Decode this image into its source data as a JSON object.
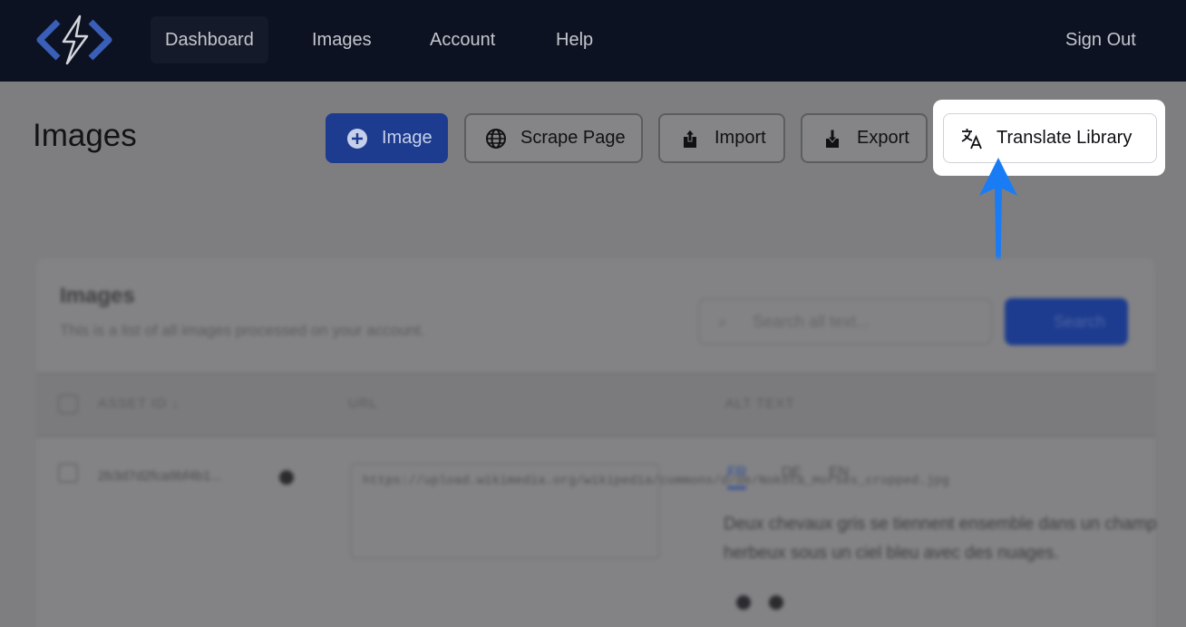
{
  "navbar": {
    "logo": "lightning-bolt-logo",
    "items": [
      {
        "label": "Dashboard",
        "active": true
      },
      {
        "label": "Images",
        "active": false
      },
      {
        "label": "Account",
        "active": false
      },
      {
        "label": "Help",
        "active": false
      }
    ],
    "sign_out": "Sign Out"
  },
  "page": {
    "title": "Images"
  },
  "toolbar": {
    "image_label": "Image",
    "scrape_label": "Scrape Page",
    "import_label": "Import",
    "export_label": "Export",
    "translate_label": "Translate Library"
  },
  "card": {
    "title": "Images",
    "subtitle": "This is a list of all images processed on your account.",
    "search_placeholder": "Search all text...",
    "search_button": "Search",
    "columns": [
      "ASSET ID ↓",
      "URL",
      "ALT TEXT"
    ],
    "row": {
      "asset_id": "2b3d7d2fca9bf4b1...",
      "url": "https://upload.wikimedia.org/wikipedia/commons/d/de/Nokota_Horses_cropped.jpg",
      "languages": [
        "FR",
        "DE",
        "EN"
      ],
      "alt_text": "Deux chevaux gris se tiennent ensemble dans un champ herbeux sous un ciel bleu avec des nuages."
    }
  },
  "colors": {
    "accent": "#2563eb",
    "navbar": "#0c1222",
    "arrow": "#1a7cf5"
  },
  "icons": {
    "image_button": "plus-circle-icon",
    "scrape_button": "globe-icon",
    "import_button": "upload-icon",
    "export_button": "download-icon",
    "translate_button": "translate-icon",
    "search": "search-icon"
  }
}
